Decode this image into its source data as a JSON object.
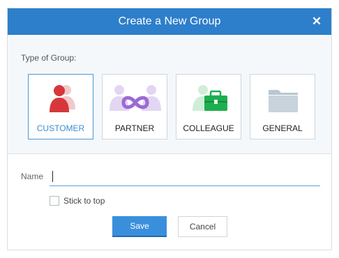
{
  "dialog": {
    "title": "Create a New Group",
    "close_glyph": "✕"
  },
  "group_type": {
    "label": "Type of Group:",
    "selected": "CUSTOMER",
    "options": [
      {
        "label": "CUSTOMER",
        "icon": "customer-people-icon",
        "color": "#d7373a"
      },
      {
        "label": "PARTNER",
        "icon": "partner-infinity-icon",
        "color": "#9b6ad6"
      },
      {
        "label": "COLLEAGUE",
        "icon": "colleague-briefcase-icon",
        "color": "#1fae4f"
      },
      {
        "label": "GENERAL",
        "icon": "general-folder-icon",
        "color": "#c8d3db"
      }
    ]
  },
  "name_field": {
    "label": "Name",
    "value": "",
    "placeholder": ""
  },
  "stick_to_top": {
    "label": "Stick to top",
    "checked": false
  },
  "buttons": {
    "save": "Save",
    "cancel": "Cancel"
  },
  "colors": {
    "header": "#2d7fcb",
    "accent": "#3a8fdc",
    "selected_text": "#3a8dd1"
  }
}
